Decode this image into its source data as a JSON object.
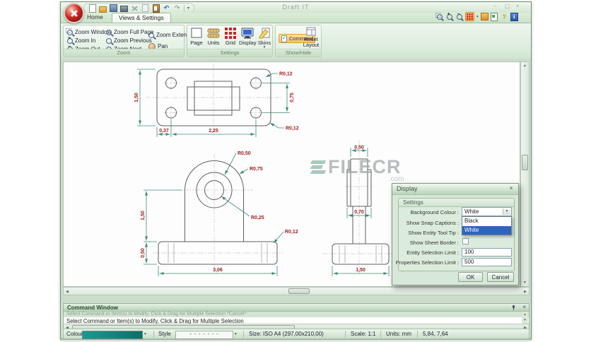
{
  "window": {
    "title": "Draft IT"
  },
  "icons": {
    "caret": "▾",
    "close": "×",
    "minimize": "–",
    "maximize": "▢",
    "check": "✓",
    "left": "◀",
    "right": "▶",
    "up": "▲",
    "down": "▼",
    "help": "?",
    "info": "i",
    "undo": "↶",
    "redo": "↷"
  },
  "tabs": {
    "home": "Home",
    "views": "Views & Settings"
  },
  "ribbon": {
    "zoom": {
      "label": "Zoom",
      "items": [
        "Zoom Window",
        "Zoom In",
        "Zoom Out",
        "Zoom Full Page",
        "Zoom Previous",
        "Zoom Next",
        "Zoom Extents",
        "Pan"
      ]
    },
    "settings": {
      "label": "Settings",
      "items": [
        "Page",
        "Units",
        "Grid",
        "Display",
        "Skins"
      ]
    },
    "showhide": {
      "label": "Show/Hide",
      "command": "Command",
      "reset": "Reset Layout"
    }
  },
  "dialog": {
    "title": "Display",
    "group": "Settings",
    "rows": {
      "bg": "Background Colour :",
      "snap": "Show Snap Captions :",
      "tooltip": "Show Entity Tool Tip :",
      "border": "Show Sheet Border :",
      "entity": "Entity Selection Limit :",
      "props": "Properties Selection Limit :"
    },
    "values": {
      "entity": "100",
      "props": "500"
    },
    "dropdown": {
      "selected": "White",
      "options": [
        "Black",
        "White"
      ]
    },
    "ok": "OK",
    "cancel": "Cancel"
  },
  "command_window": {
    "title": "Command Window",
    "history": "Select Command or Item(s) to Modify, Click & Drag for Multiple Selection   *Cancel*",
    "prompt": "Select Command or Item(s) to Modify, Click & Drag for Multiple Selection"
  },
  "status": {
    "colour_label": "Colour",
    "style_label": "Style",
    "style_pattern": "- - - - - - -",
    "size": "Size: ISO A4 (297,00x210,00)",
    "scale": "Scale: 1:1",
    "units": "Units: mm",
    "coords": "5,84, 7,64",
    "swatch_color": "#17867e"
  },
  "drawing": {
    "labels": {
      "tv_h": "1,50",
      "tv_r": "0,75",
      "tv_b1": "0,37",
      "tv_b2": "2,25",
      "tv_r12a": "R0,12",
      "tv_r12b": "R0,12",
      "fv_r050": "R0,50",
      "fv_r075": "R0,75",
      "fv_r025": "R0,25",
      "fv_r12": "R0,12",
      "fv_h1": "1,50",
      "fv_h2": "0,50",
      "fv_w": "3,06",
      "sv_t": "0,50",
      "sv_m": "0,70",
      "sv_b": "1,50"
    }
  },
  "watermark": {
    "text": "FILECR",
    "suffix": ".com"
  }
}
